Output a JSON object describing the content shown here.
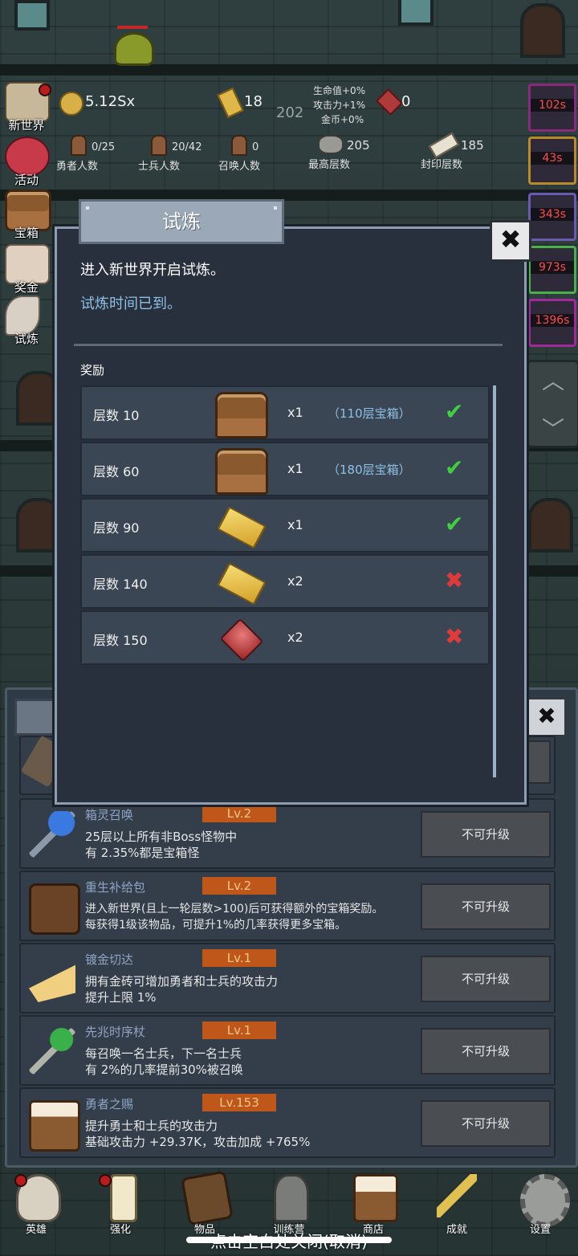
{
  "top_stats": {
    "gold": "5.12Sx",
    "gold_bars": "18",
    "floor_center": "202",
    "bonus_hp": "生命值+0%",
    "bonus_atk": "攻击力+1%",
    "bonus_gold": "金币+0%",
    "gems": "0",
    "heroes_value": "0/25",
    "heroes_label": "勇者人数",
    "soldiers_value": "20/42",
    "soldiers_label": "士兵人数",
    "summons_value": "0",
    "summons_label": "召唤人数",
    "max_floor_value": "205",
    "max_floor_label": "最高层数",
    "sealed_floor_value": "185",
    "sealed_floor_label": "封印层数"
  },
  "left_menu": [
    {
      "label": "新世界",
      "icon": "map-icon"
    },
    {
      "label": "活动",
      "icon": "heart-icon"
    },
    {
      "label": "宝箱",
      "icon": "chest-icon"
    },
    {
      "label": "奖金",
      "icon": "envelope-icon"
    },
    {
      "label": "试炼",
      "icon": "feather-icon"
    }
  ],
  "right_timers": [
    "102s",
    "43s",
    "343s",
    "973s",
    "1396s"
  ],
  "modal": {
    "title": "试炼",
    "line1": "进入新世界开启试炼。",
    "line2": "试炼时间已到。",
    "reward_heading": "奖励",
    "rewards": [
      {
        "label": "层数 10",
        "icon": "chest-icon",
        "qty": "x1",
        "note": "（110层宝箱）",
        "status": "✔",
        "done": true
      },
      {
        "label": "层数 60",
        "icon": "chest-icon",
        "qty": "x1",
        "note": "（180层宝箱）",
        "status": "✔",
        "done": true
      },
      {
        "label": "层数 90",
        "icon": "gold-bar-icon",
        "qty": "x1",
        "note": "",
        "status": "✔",
        "done": true
      },
      {
        "label": "层数 140",
        "icon": "gold-bar-icon",
        "qty": "x2",
        "note": "",
        "status": "✖",
        "done": false
      },
      {
        "label": "层数 150",
        "icon": "ruby-icon",
        "qty": "x2",
        "note": "",
        "status": "✖",
        "done": false
      }
    ]
  },
  "items": [
    {
      "name": "箱灵召唤",
      "level": "Lv.2",
      "desc1": "25层以上所有非Boss怪物中",
      "desc2": "有 2.35%都是宝箱怪",
      "button": "不可升级",
      "icon": "staff-blue-icon"
    },
    {
      "name": "重生补给包",
      "level": "Lv.2",
      "desc1": "进入新世界(且上一轮层数>100)后可获得额外的宝箱奖励。",
      "desc2": "每获得1级该物品，可提升1%的几率获得更多宝箱。",
      "button": "不可升级",
      "icon": "backpack-icon"
    },
    {
      "name": "镀金切达",
      "level": "Lv.1",
      "desc1": "拥有金砖可增加勇者和士兵的攻击力",
      "desc2": "提升上限 1%",
      "button": "不可升级",
      "icon": "cheese-icon"
    },
    {
      "name": "先兆时序杖",
      "level": "Lv.1",
      "desc1": "每召唤一名士兵，下一名士兵",
      "desc2": "有 2%的几率提前30%被召唤",
      "button": "不可升级",
      "icon": "staff-green-icon"
    },
    {
      "name": "勇者之赐",
      "level": "Lv.153",
      "desc1": "提升勇士和士兵的攻击力",
      "desc2": "基础攻击力 +29.37K，攻击加成 +765%",
      "button": "不可升级",
      "icon": "mug-icon"
    }
  ],
  "bottom_nav": [
    {
      "label": "英雄",
      "icon": "skull-icon"
    },
    {
      "label": "强化",
      "icon": "candle-icon"
    },
    {
      "label": "物品",
      "icon": "book-icon"
    },
    {
      "label": "训练营",
      "icon": "lantern-icon"
    },
    {
      "label": "商店",
      "icon": "beer-icon"
    },
    {
      "label": "成就",
      "icon": "key-icon"
    },
    {
      "label": "设置",
      "icon": "gear-icon"
    }
  ],
  "hint": "点击空白处关闭(取消)",
  "colors": {
    "accent": "#8ec0e6",
    "ok": "#3fcf3f",
    "fail": "#e03a3a",
    "level_badge": "#c0571a"
  }
}
